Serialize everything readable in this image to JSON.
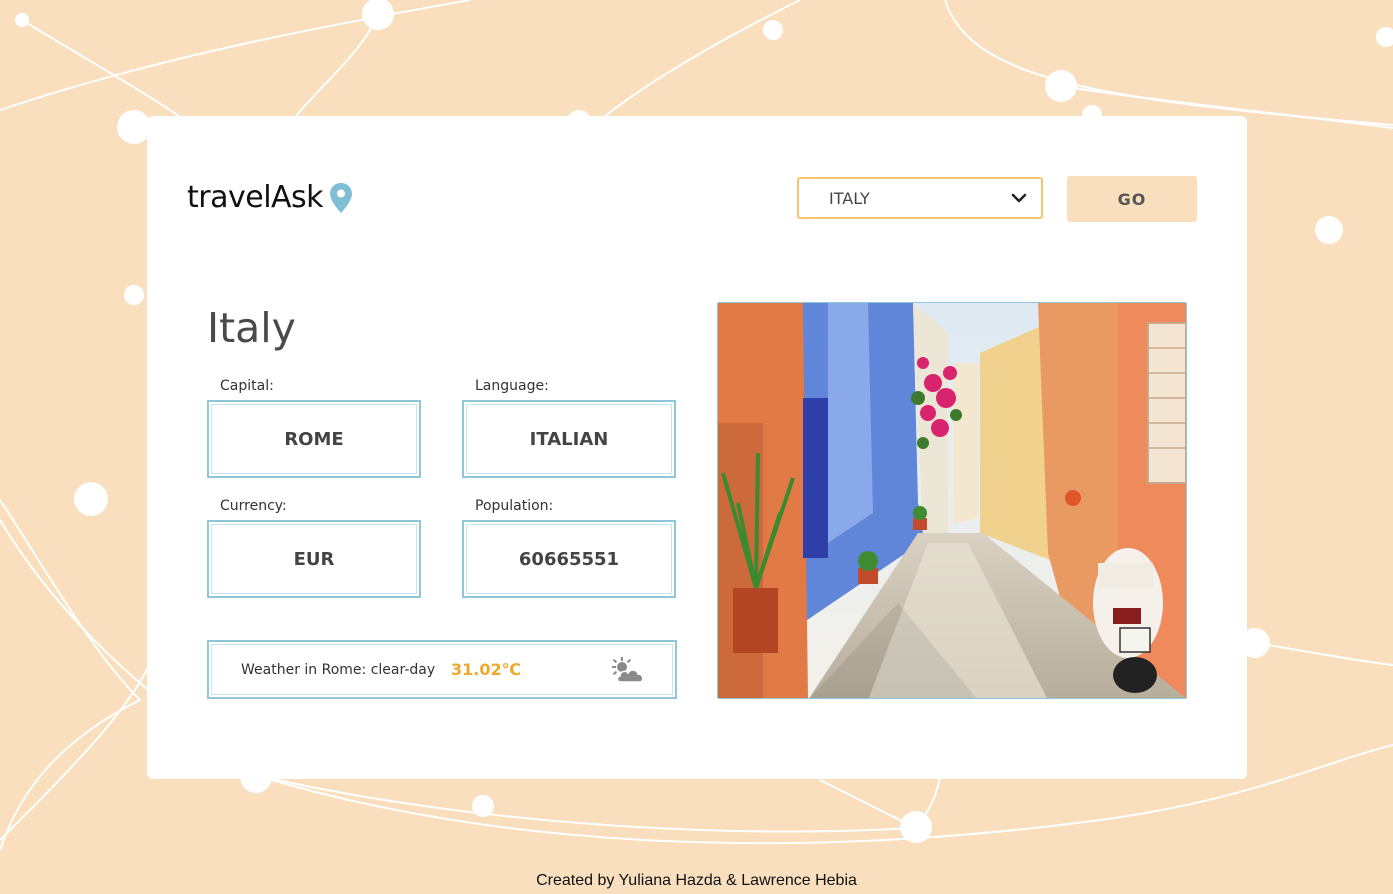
{
  "app": {
    "logo_text": "travelAsk"
  },
  "search": {
    "selected_country": "ITALY",
    "go_label": "GO"
  },
  "country": {
    "name": "Italy",
    "capital_label": "Capital:",
    "capital": "ROME",
    "language_label": "Language:",
    "language": "ITALIAN",
    "currency_label": "Currency:",
    "currency": "EUR",
    "population_label": "Population:",
    "population": "60665551"
  },
  "weather": {
    "label": "Weather in Rome: clear-day",
    "temperature": "31.02℃",
    "icon": "partly-cloudy-sun-icon"
  },
  "photo": {
    "icon": "italian-street-photo"
  },
  "footer": {
    "credit": "Created by Yuliana Hazda & Lawrence Hebia"
  },
  "colors": {
    "background": "#f9dfbe",
    "accent": "#f5c56b",
    "border": "#8fc7d6",
    "temperature": "#f0a830"
  }
}
